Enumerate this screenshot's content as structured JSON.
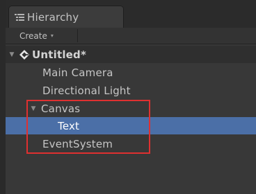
{
  "panel": {
    "tab_label": "Hierarchy",
    "tab_icon": "list-icon",
    "create_label": "Create",
    "create_arrow": "▾"
  },
  "scene": {
    "name": "Untitled*",
    "icon": "unity-scene-icon",
    "expanded": true
  },
  "items": [
    {
      "label": "Main Camera",
      "depth": 1,
      "has_children": false,
      "selected": false
    },
    {
      "label": "Directional Light",
      "depth": 1,
      "has_children": false,
      "selected": false
    },
    {
      "label": "Canvas",
      "depth": 1,
      "has_children": true,
      "expanded": true,
      "selected": false
    },
    {
      "label": "Text",
      "depth": 2,
      "has_children": false,
      "selected": true
    },
    {
      "label": "EventSystem",
      "depth": 1,
      "has_children": false,
      "selected": false
    }
  ],
  "colors": {
    "background": "#383838",
    "selection": "#4b6fa7",
    "highlight_box": "#e03030"
  }
}
